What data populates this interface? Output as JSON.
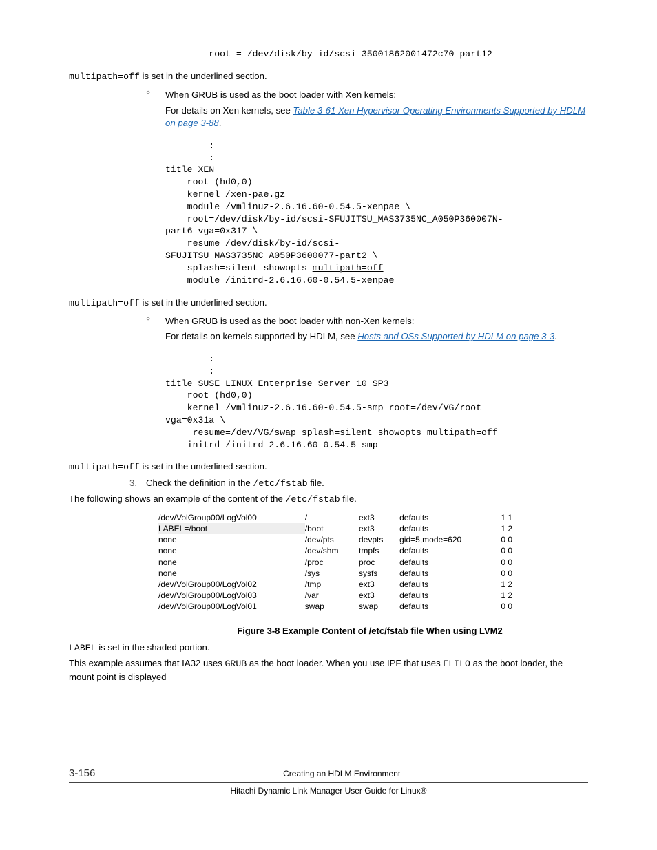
{
  "top_code_line": "        root = /dev/disk/by-id/scsi-35001862001472c70-part12",
  "multipath_note_a_pre": "multipath=off",
  "multipath_note_a_post": " is set in the underlined section.",
  "bullet2_head": "When GRUB is used as the boot loader with Xen kernels:",
  "bullet2_pre": "For details on Xen kernels, see ",
  "bullet2_link": "Table 3-61 Xen Hypervisor Operating Environments Supported by HDLM on page 3-88",
  "code2_l1": "        :",
  "code2_l2": "        :",
  "code2_l3": "title XEN",
  "code2_l4": "    root (hd0,0)",
  "code2_l5": "    kernel /xen-pae.gz",
  "code2_l6": "    module /vmlinuz-2.6.16.60-0.54.5-xenpae \\",
  "code2_l7a": "    root=/dev/disk/by-id/scsi-SFUJITSU_MAS3735NC_A050P360007N-",
  "code2_l7b": "part6 vga=0x317 \\",
  "code2_l8a": "    resume=/dev/disk/by-id/scsi-",
  "code2_l8b": "SFUJITSU_MAS3735NC_A050P3600077-part2 \\",
  "code2_l9a": "    splash=silent showopts ",
  "code2_l9b": "multipath=off",
  "code2_l10": "    module /initrd-2.6.16.60-0.54.5-xenpae",
  "bullet3_head": "When GRUB is used as the boot loader with non-Xen kernels:",
  "bullet3_pre": "For details on kernels supported by HDLM, see ",
  "bullet3_link": "Hosts and OSs Supported by HDLM on page 3-3",
  "code3_l1": "        :",
  "code3_l2": "        :",
  "code3_l3": "title SUSE LINUX Enterprise Server 10 SP3",
  "code3_l4": "    root (hd0,0)",
  "code3_l5a": "    kernel /vmlinuz-2.6.16.60-0.54.5-smp root=/dev/VG/root ",
  "code3_l5b": "vga=0x31a \\",
  "code3_l6a": "     resume=/dev/VG/swap splash=silent showopts ",
  "code3_l6b": "multipath=off",
  "code3_l7": "    initrd /initrd-2.6.16.60-0.54.5-smp",
  "step3_num": "3.",
  "step3_head_pre": "Check the definition in the ",
  "step3_head_mono": "/etc/fstab",
  "step3_head_post": " file.",
  "step3_body_pre": "The following shows an example of the content of the ",
  "step3_body_mono": "/etc/fstab",
  "step3_body_post": " file.",
  "fstab": {
    "rows": [
      {
        "c1": "/dev/VolGroup00/LogVol00",
        "c2": "/",
        "c3": "ext3",
        "c4": "defaults",
        "c5": "1 1",
        "shade": false
      },
      {
        "c1": "LABEL=/boot",
        "c2": "/boot",
        "c3": "ext3",
        "c4": "defaults",
        "c5": "1 2",
        "shade": true
      },
      {
        "c1": "none",
        "c2": "/dev/pts",
        "c3": "devpts",
        "c4": "gid=5,mode=620",
        "c5": "0 0",
        "shade": false
      },
      {
        "c1": "none",
        "c2": "/dev/shm",
        "c3": "tmpfs",
        "c4": "defaults",
        "c5": "0 0",
        "shade": false
      },
      {
        "c1": "none",
        "c2": "/proc",
        "c3": "proc",
        "c4": "defaults",
        "c5": "0 0",
        "shade": false
      },
      {
        "c1": "none",
        "c2": "/sys",
        "c3": "sysfs",
        "c4": "defaults",
        "c5": "0 0",
        "shade": false
      },
      {
        "c1": "/dev/VolGroup00/LogVol02",
        "c2": "/tmp",
        "c3": "ext3",
        "c4": "defaults",
        "c5": "1 2",
        "shade": false
      },
      {
        "c1": "/dev/VolGroup00/LogVol03",
        "c2": "/var",
        "c3": "ext3",
        "c4": "defaults",
        "c5": "1 2",
        "shade": false
      },
      {
        "c1": "/dev/VolGroup00/LogVol01",
        "c2": "swap",
        "c3": "swap",
        "c4": "defaults",
        "c5": "0 0",
        "shade": false
      }
    ]
  },
  "figure_caption": "Figure 3-8 Example Content of /etc/fstab file When using LVM2",
  "label_pre": "LABEL",
  "label_post": " is set in the shaded portion.",
  "example_p1_pre": "This example assumes that IA32 uses ",
  "example_p1_mono1": "GRUB",
  "example_p1_mid": " as the boot loader. When you use IPF that uses ",
  "example_p1_mono2": "ELILO",
  "example_p1_post": " as the boot loader, the mount point is displayed",
  "footer_page": "3-156",
  "footer_c1": "Creating an HDLM Environment",
  "footer_c2": "Hitachi Dynamic Link Manager User Guide for Linux®"
}
